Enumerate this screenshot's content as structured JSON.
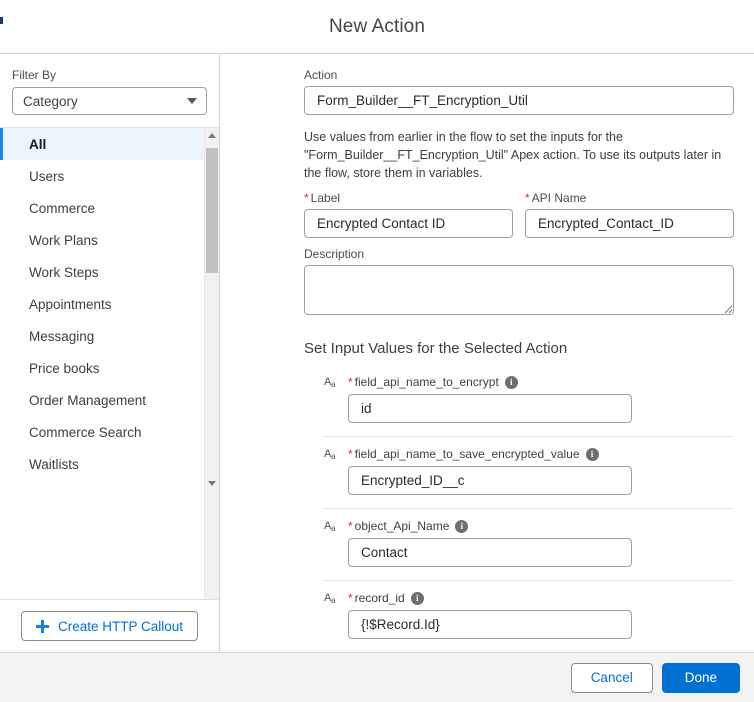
{
  "header": {
    "title": "New Action"
  },
  "sidebar": {
    "filter_label": "Filter By",
    "filter_value": "Category",
    "caret_icon": "chevron-down-icon",
    "scroll_up_icon": "scroll-up-arrow-icon",
    "scroll_down_icon": "scroll-down-arrow-icon",
    "items": [
      {
        "label": "All",
        "selected": true
      },
      {
        "label": "Users",
        "selected": false
      },
      {
        "label": "Commerce",
        "selected": false
      },
      {
        "label": "Work Plans",
        "selected": false
      },
      {
        "label": "Work Steps",
        "selected": false
      },
      {
        "label": "Appointments",
        "selected": false
      },
      {
        "label": "Messaging",
        "selected": false
      },
      {
        "label": "Price books",
        "selected": false
      },
      {
        "label": "Order Management",
        "selected": false
      },
      {
        "label": "Commerce Search",
        "selected": false
      },
      {
        "label": "Waitlists",
        "selected": false
      }
    ],
    "create_callout_label": "Create HTTP Callout",
    "plus_icon": "plus-icon"
  },
  "main": {
    "action_field": {
      "label": "Action",
      "value": "Form_Builder__FT_Encryption_Util"
    },
    "help_text": "Use values from earlier in the flow to set the inputs for the \"Form_Builder__FT_Encryption_Util\" Apex action. To use its outputs later in the flow, store them in variables.",
    "label_field": {
      "required_mark": "*",
      "label": "Label",
      "value": "Encrypted Contact ID"
    },
    "api_name_field": {
      "required_mark": "*",
      "label": "API Name",
      "value": "Encrypted_Contact_ID"
    },
    "description_field": {
      "label": "Description",
      "value": ""
    },
    "inputs_section_title": "Set Input Values for the Selected Action",
    "inputs": [
      {
        "datatype_icon": "text-datatype-icon",
        "datatype_glyph": "A",
        "datatype_sub": "a",
        "required_mark": "*",
        "name": "field_api_name_to_encrypt",
        "info_icon": "info-icon",
        "info_glyph": "i",
        "value": "id"
      },
      {
        "datatype_icon": "text-datatype-icon",
        "datatype_glyph": "A",
        "datatype_sub": "a",
        "required_mark": "*",
        "name": "field_api_name_to_save_encrypted_value",
        "info_icon": "info-icon",
        "info_glyph": "i",
        "value": "Encrypted_ID__c"
      },
      {
        "datatype_icon": "text-datatype-icon",
        "datatype_glyph": "A",
        "datatype_sub": "a",
        "required_mark": "*",
        "name": "object_Api_Name",
        "info_icon": "info-icon",
        "info_glyph": "i",
        "value": "Contact"
      },
      {
        "datatype_icon": "text-datatype-icon",
        "datatype_glyph": "A",
        "datatype_sub": "a",
        "required_mark": "*",
        "name": "record_id",
        "info_icon": "info-icon",
        "info_glyph": "i",
        "value": "{!$Record.Id}"
      }
    ]
  },
  "footer": {
    "cancel_label": "Cancel",
    "done_label": "Done"
  },
  "colors": {
    "brand_blue": "#0070d2",
    "link_blue": "#0070d2",
    "selected_row_bg": "#ecf5fd",
    "accent_bar": "#1589ee",
    "required_red": "#c23934",
    "footer_bg": "#f3f3f3",
    "border_gray": "#d4d4d4"
  }
}
